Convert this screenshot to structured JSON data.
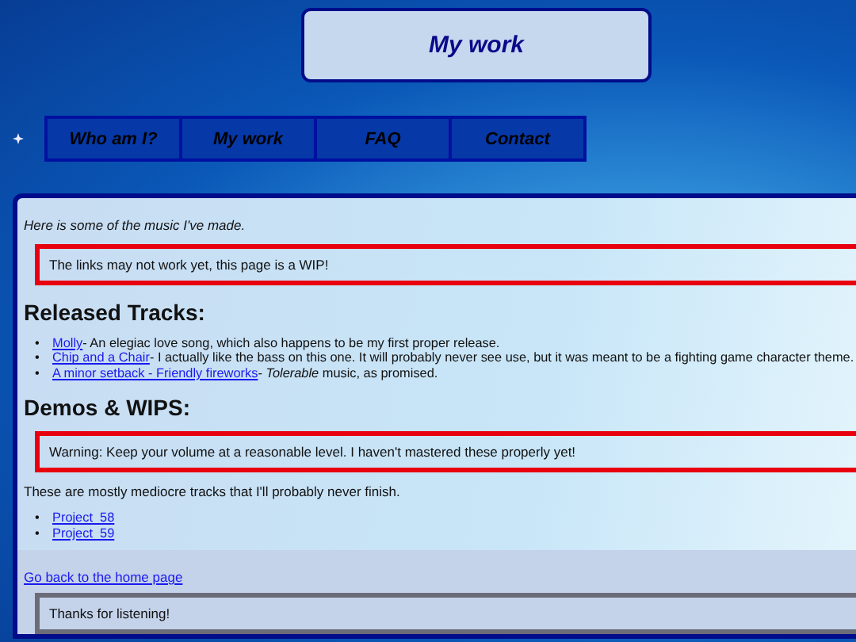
{
  "header": {
    "title": "My work"
  },
  "nav": [
    {
      "label": "Who am I?"
    },
    {
      "label": "My work"
    },
    {
      "label": "FAQ"
    },
    {
      "label": "Contact"
    }
  ],
  "main": {
    "intro": "Here is some of the music I've made.",
    "notice": "The links may not work yet, this page is a WIP!",
    "released": {
      "heading": "Released Tracks:",
      "tracks": [
        {
          "bullet": "•",
          "link": "Molly",
          "description": " - An elegiac love song, which also happens to be my first proper release."
        },
        {
          "bullet": "•",
          "link": "Chip and a Chair",
          "description": " - I actually like the bass on this one. It will probably never see use, but it was meant to be a fighting game character theme."
        },
        {
          "bullet": "•",
          "link": "A minor setback - Friendly fireworks",
          "description": " - *Tolerable* music, as promised."
        }
      ]
    },
    "demos": {
      "heading": "Demos & WIPS:",
      "warning": "Warning: Keep your volume at a reasonable level. I haven't mastered these properly yet!",
      "text": "These are mostly mediocre tracks that I'll probably never finish.",
      "projects": [
        {
          "bullet": "•",
          "link": "Project_58"
        },
        {
          "bullet": "•",
          "link": "Project_59"
        }
      ]
    }
  },
  "footer": {
    "link": "Go back to the home page",
    "note": "Thanks for listening!"
  }
}
